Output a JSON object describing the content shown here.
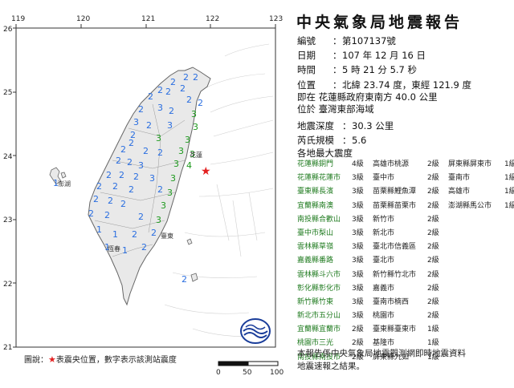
{
  "map": {
    "lon_ticks": [
      "119",
      "120",
      "121",
      "122",
      "123"
    ],
    "lat_ticks": [
      "26",
      "25",
      "24",
      "23",
      "22",
      "21"
    ],
    "scale_labels": [
      "0",
      "50",
      "100"
    ],
    "place_labels": [
      "花蓮",
      "臺東",
      "恆春",
      "澎湖"
    ],
    "epicenter": {
      "lon": 121.9,
      "lat": 23.74
    },
    "station_intensity_color": "#2a6ee0",
    "high_intensity_color": "#1e9a1e",
    "coast_color": "#6a6a6a"
  },
  "legend": {
    "prefix": "圖說：",
    "star": "★",
    "text": "表震央位置，數字表示該測站震度"
  },
  "report": {
    "title": "中央氣象局地震報告",
    "number_label": "編號",
    "number_value": "第107137號",
    "date_label": "日期",
    "date_value": "107 年 12 月 16 日",
    "time_label": "時間",
    "time_value": "5 時 21 分 5.7 秒",
    "position_label": "位置",
    "position_value": "北緯 23.74 度，東經 121.9 度",
    "position_line2": "即在 花蓮縣政府東南方 40.0 公里",
    "position_line3": "位於 臺灣東部海域",
    "depth_label": "地震深度",
    "depth_value": "30.3 公里",
    "magnitude_label": "芮氏規模",
    "magnitude_value": "5.6",
    "max_intensity_heading": "各地最大震度",
    "intensity_rows": [
      [
        [
          "花蓮縣銅門",
          "4級"
        ],
        [
          "高雄市桃源",
          "2級"
        ],
        [
          "屏東縣屏東市",
          "1級"
        ]
      ],
      [
        [
          "花蓮縣花蓮市",
          "3級"
        ],
        [
          "臺中市",
          "2級"
        ],
        [
          "臺南市",
          "1級"
        ]
      ],
      [
        [
          "臺東縣長濱",
          "3級"
        ],
        [
          "苗栗縣鯉魚潭",
          "2級"
        ],
        [
          "高雄市",
          "1級"
        ]
      ],
      [
        [
          "宜蘭縣南澳",
          "3級"
        ],
        [
          "苗栗縣苗栗市",
          "2級"
        ],
        [
          "澎湖縣馬公市",
          "1級"
        ]
      ],
      [
        [
          "南投縣合歡山",
          "3級"
        ],
        [
          "新竹市",
          "2級"
        ],
        null
      ],
      [
        [
          "臺中市梨山",
          "3級"
        ],
        [
          "新北市",
          "2級"
        ],
        null
      ],
      [
        [
          "雲林縣草嶺",
          "3級"
        ],
        [
          "臺北市信義區",
          "2級"
        ],
        null
      ],
      [
        [
          "嘉義縣番路",
          "3級"
        ],
        [
          "臺北市",
          "2級"
        ],
        null
      ],
      [
        [
          "雲林縣斗六市",
          "3級"
        ],
        [
          "新竹縣竹北市",
          "2級"
        ],
        null
      ],
      [
        [
          "彰化縣彰化市",
          "3級"
        ],
        [
          "嘉義市",
          "2級"
        ],
        null
      ],
      [
        [
          "新竹縣竹東",
          "3級"
        ],
        [
          "臺南市楠西",
          "2級"
        ],
        null
      ],
      [
        [
          "新北市五分山",
          "3級"
        ],
        [
          "桃園市",
          "2級"
        ],
        null
      ],
      [
        [
          "宜蘭縣宜蘭市",
          "2級"
        ],
        [
          "臺東縣臺東市",
          "1級"
        ],
        null
      ],
      [
        [
          "桃園市三光",
          "2級"
        ],
        [
          "基隆市",
          "1級"
        ],
        null
      ],
      [
        [
          "南投縣南投市",
          "2級"
        ],
        [
          "屏東縣九如",
          "1級"
        ],
        null
      ]
    ],
    "footer_line1": "本報告係中央氣象局地震觀測網即時地震資料",
    "footer_line2": "地震速報之結果。"
  }
}
